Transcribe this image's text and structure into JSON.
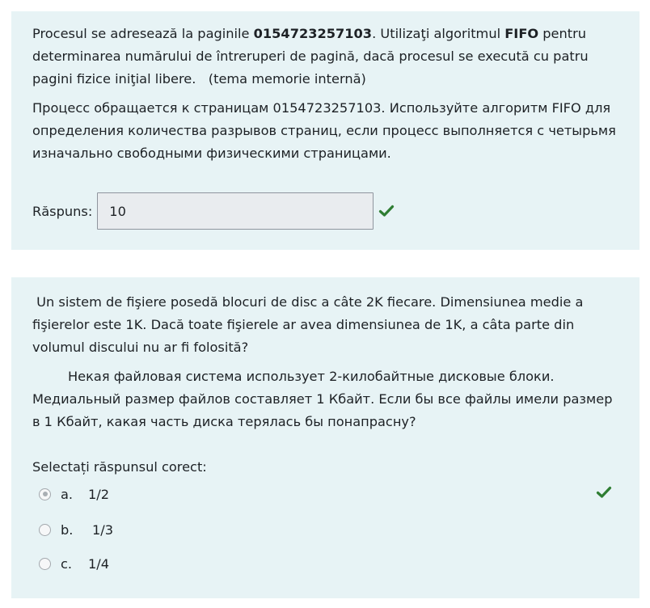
{
  "question1": {
    "ro_text_1": "Procesul se adresează la paginile ",
    "ro_bold_pages": "0154723257103",
    "ro_text_2": ". Utilizaţi algoritmul ",
    "ro_bold_algo": "FIFO",
    "ro_text_3": " pentru",
    "ro_line2": "determinarea numărului de întreruperi de pagină, dacă procesul se execută cu patru",
    "ro_line3": "pagini fizice iniţial libere.   (tema memorie internă)",
    "ru_line1": "Процесс обращается к страницам 0154723257103. Используйте алгоритм FIFO для",
    "ru_line2": "определения количества разрывов страниц, если процесс выполняется с четырьмя",
    "ru_line3": "изначально свободными физическими страницами.",
    "answer_label": "Răspuns:",
    "answer_value": "10",
    "status_icon": "check-icon",
    "status_color": "#2e7d32"
  },
  "question2": {
    "ro_line1": " Un sistem de fişiere posedă blocuri de disc a câte 2K fiecare. Dimensiunea medie a",
    "ro_line2": "fişierelor este 1K. Dacă toate fişierele ar avea dimensiunea de 1K, a câta parte din",
    "ro_line3": "volumul discului nu ar fi folosită?",
    "ru_line1": "Некая файловая система использует 2-килобайтные дисковые блоки.",
    "ru_line2": "Медиальный размер файлов составляет 1 Кбайт. Если бы все файлы имели размер",
    "ru_line3": "в 1 Кбайт, какая часть диска терялась бы понапрасну?",
    "prompt": "Selectați răspunsul corect:",
    "options": [
      {
        "letter": "a.",
        "text": "1/2",
        "selected": true
      },
      {
        "letter": "b.",
        "text": "1/3",
        "selected": false
      },
      {
        "letter": "c.",
        "text": "1/4",
        "selected": false
      }
    ],
    "status_icon": "check-icon",
    "status_color": "#2e7d32"
  },
  "colors": {
    "card_background": "#e7f3f5",
    "input_background": "#e9ecef",
    "text": "#1d2125"
  }
}
